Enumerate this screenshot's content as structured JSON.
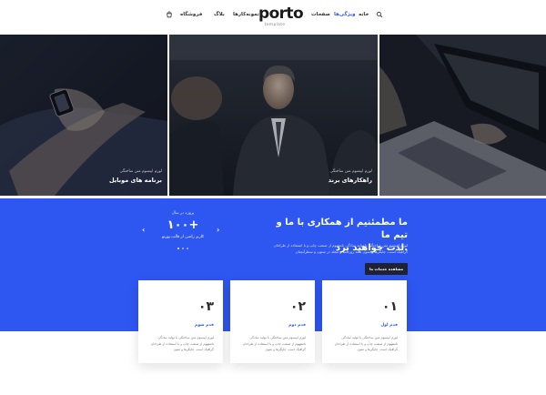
{
  "header": {
    "logo": "porto",
    "logo_sub": "template",
    "nav": {
      "home": "خانه",
      "features": "ویژگی‌ها",
      "pages": "صفحات",
      "elements": "تمونه‌کارها",
      "blog": "بلاگ",
      "shop": "فروشگاه"
    },
    "icons": {
      "search": "search-icon",
      "cart": "cart-icon"
    }
  },
  "hero": {
    "panels": [
      {
        "small": "لورم ایپسوم متن ساختگی",
        "title": "برنامه های موبایل"
      },
      {
        "small": "لورم ایپسوم متن ساختگی",
        "title": "راهکارهای برند"
      },
      {
        "small": "",
        "title": ""
      }
    ]
  },
  "band": {
    "title_line1": "ما مطمئنیم از همکاری با ما و تیم ما",
    "title_line2": "لذت خواهید برد.",
    "text": "لورم ایپسوم متن ساختگی با تولید سادگی نامفهوم از صنعت چاپ و با استفاده از طراحان گرافیک است. چاپگرها و متون بلکه روزنامه و مجله در ستون و سطرآنچنان",
    "button": "مشاهده خدمات ما",
    "stat": {
      "top": "پروژه در سال",
      "number": "۱۰۰",
      "plus": "+",
      "sub": "کاربر راضی از قالب پورتو"
    },
    "accent": "#2e56f1"
  },
  "cards": [
    {
      "num": "۰۳",
      "label": "قدم سوم",
      "text": "لورم ایپسوم متن ساختگی با تولید سادگی نامفهوم از صنعت چاپ و با استفاده از طراحان گرافیک است. چاپگرها و متون"
    },
    {
      "num": "۰۲",
      "label": "قدم دوم",
      "text": "لورم ایپسوم متن ساختگی با تولید سادگی نامفهوم از صنعت چاپ و با استفاده از طراحان گرافیک است. چاپگرها و متون"
    },
    {
      "num": "۰۱",
      "label": "قدم اول",
      "text": "لورم ایپسوم متن ساختگی با تولید سادگی نامفهوم از صنعت چاپ و با استفاده از طراحان گرافیک است. چاپگرها و متون"
    }
  ]
}
